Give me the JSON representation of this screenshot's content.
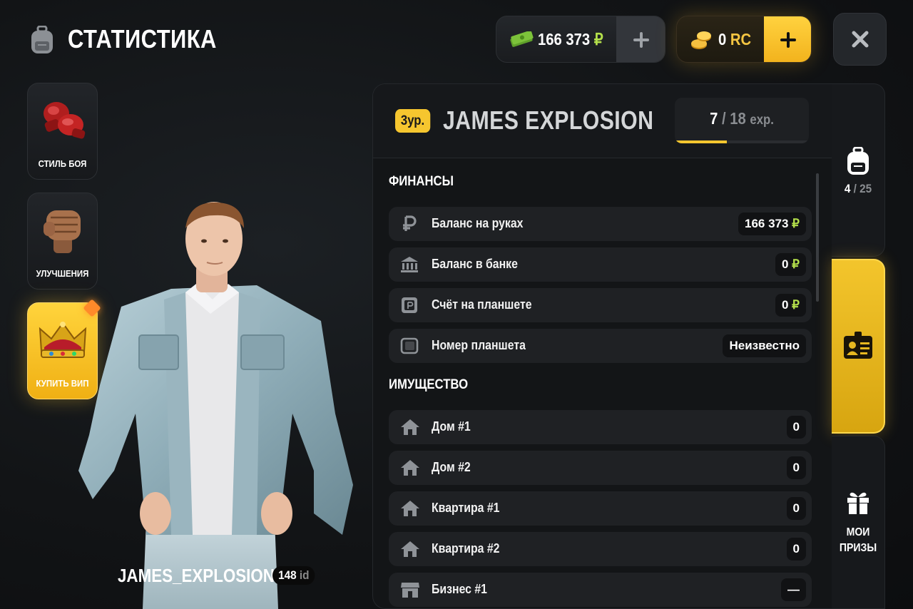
{
  "header": {
    "title": "СТАТИСТИКА",
    "icon": "backpack-icon"
  },
  "wallet": {
    "cash_value": "166 373",
    "cash_currency": "₽",
    "rc_value": "0",
    "rc_currency": "RC",
    "plus_label": "+",
    "close_label": "✕"
  },
  "side_menu": [
    {
      "label": "СТИЛЬ БОЯ",
      "icon": "boxing-gloves-icon"
    },
    {
      "label": "УЛУЧШЕНИЯ",
      "icon": "fist-icon"
    },
    {
      "label": "КУПИТЬ ВИП",
      "icon": "crown-icon"
    }
  ],
  "player": {
    "name": "JAMES_EXPLOSION",
    "id": "148",
    "id_suffix": "id"
  },
  "profile": {
    "level_badge": "3ур.",
    "display_name": "JAMES EXPLOSION",
    "exp_current": "7",
    "exp_sep": "/",
    "exp_max": "18",
    "exp_unit": "exp.",
    "exp_fraction": 0.389
  },
  "finances": {
    "title": "ФИНАНСЫ",
    "rows": [
      {
        "label": "Баланс на руках",
        "value": "166 373",
        "currency": "₽",
        "icon": "ruble-icon"
      },
      {
        "label": "Баланс в банке",
        "value": "0",
        "currency": "₽",
        "icon": "bank-icon"
      },
      {
        "label": "Счёт на планшете",
        "value": "0",
        "currency": "₽",
        "icon": "tablet-account-icon"
      },
      {
        "label": "Номер планшета",
        "value": "Неизвестно",
        "currency": "",
        "icon": "tablet-icon"
      }
    ]
  },
  "property": {
    "title": "ИМУЩЕСТВО",
    "rows": [
      {
        "label": "Дом #1",
        "value": "0",
        "icon": "house-icon"
      },
      {
        "label": "Дом #2",
        "value": "0",
        "icon": "house-icon"
      },
      {
        "label": "Квартира #1",
        "value": "0",
        "icon": "house-icon"
      },
      {
        "label": "Квартира #2",
        "value": "0",
        "icon": "house-icon"
      },
      {
        "label": "Бизнес #1",
        "value": "—",
        "icon": "shop-icon"
      }
    ]
  },
  "right_tabs": {
    "inventory_count": "4",
    "inventory_sep": "/",
    "inventory_max": "25",
    "prizes_line1": "МОИ",
    "prizes_line2": "ПРИЗЫ"
  },
  "colors": {
    "accent_gold": "#f6c62f",
    "cash_green": "#b4e04b",
    "panel_bg": "#131517",
    "row_bg": "#1f2124"
  }
}
